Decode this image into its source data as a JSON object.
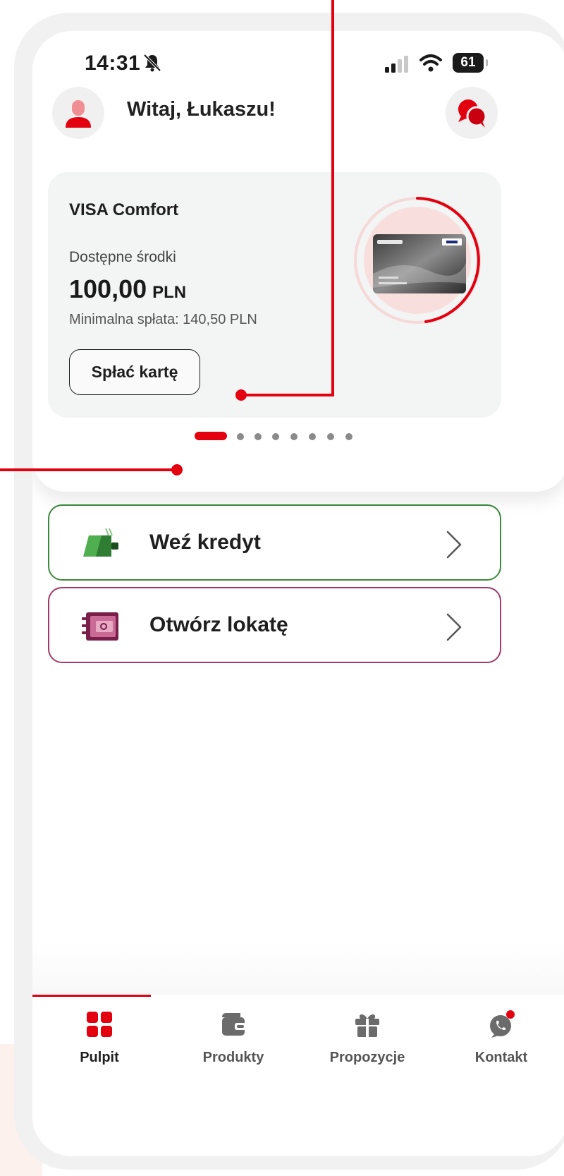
{
  "status_bar": {
    "time": "14:31",
    "battery": "61"
  },
  "header": {
    "greeting": "Witaj, Łukaszu!"
  },
  "card": {
    "name": "VISA Comfort",
    "available_label": "Dostępne środki",
    "amount": "100,00",
    "currency": "PLN",
    "min_payment": "Minimalna spłata: 140,50 PLN",
    "pay_button": "Spłać kartę",
    "carousel_count": 8,
    "carousel_active": 1,
    "colors": {
      "accent": "#e3000f"
    }
  },
  "actions": [
    {
      "label": "Weź kredyt",
      "icon": "wallet-icon",
      "color": "#3c8a3c"
    },
    {
      "label": "Otwórz lokatę",
      "icon": "safe-icon",
      "color": "#a03a68"
    }
  ],
  "tabs": [
    {
      "label": "Pulpit",
      "icon": "dashboard-icon",
      "active": true
    },
    {
      "label": "Produkty",
      "icon": "wallet-icon",
      "active": false
    },
    {
      "label": "Propozycje",
      "icon": "gift-icon",
      "active": false
    },
    {
      "label": "Kontakt",
      "icon": "contact-icon",
      "active": false,
      "notification": true
    }
  ]
}
